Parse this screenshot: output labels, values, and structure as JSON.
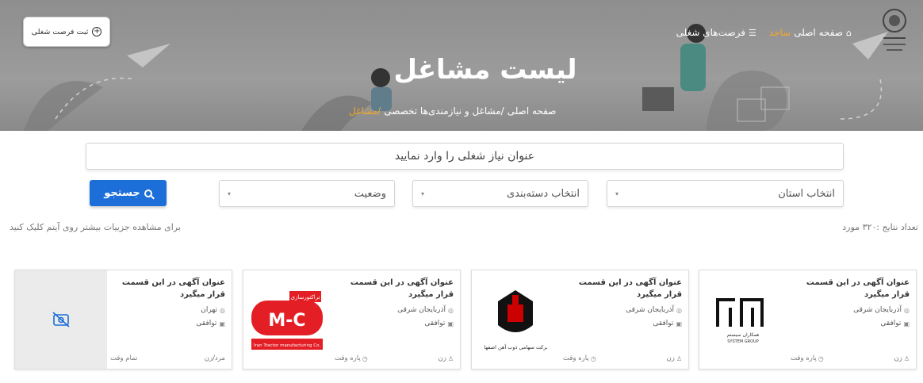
{
  "nav": {
    "home": "صفحه اصلی",
    "brand": "ساجد",
    "jobs": "فرصت‌های شغلی"
  },
  "post_job": {
    "label": "ثبت فرصت شغلی"
  },
  "hero": {
    "title": "لیست مشاغل",
    "breadcrumb": [
      "صفحه اصلی",
      "/مشاغل و نیازمندی‌ها تخصصی",
      "/مشاغل"
    ]
  },
  "search": {
    "placeholder": "عنوان نیاز شغلی را وارد نمایید",
    "province": "انتخاب استان",
    "category": "انتخاب دسته‌بندی",
    "status": "وضعیت",
    "button": "جستجو"
  },
  "results": {
    "count_text": "تعداد نتایج :۳۲۰ مورد",
    "hint": "برای مشاهده جزییات بیشتر روی آیتم کلیک کنید"
  },
  "cards": [
    {
      "title": "عنوان آگهی در این قسمت قرار میگیرد",
      "location": "آذربایجان شرقی",
      "salary": "توافقی",
      "gender": "زن",
      "type": "پاره وقت",
      "logo": "system-group-logo",
      "logo_text": "SYSTEM GROUP",
      "logo_fa": "همکاران سیستم"
    },
    {
      "title": "عنوان آگهی در این قسمت قرار میگیرد",
      "location": "آذربایجان شرقی",
      "salary": "توافقی",
      "gender": "زن",
      "type": "پاره وقت",
      "logo": "isfahan-steel-logo",
      "logo_text": "شرکت سهامی ذوب آهن اصفهان"
    },
    {
      "title": "عنوان آگهی در این قسمت قرار میگیرد",
      "location": "آذربایجان شرقی",
      "salary": "توافقی",
      "gender": "زن",
      "type": "پاره وقت",
      "logo": "itmco-logo",
      "logo_text": "Iran Tractor manufacturing Co.",
      "logo_fa": "تراکتورسازی"
    },
    {
      "title": "عنوان آگهی در این قسمت قرار میگیرد",
      "location": "تهران",
      "salary": "توافقی",
      "gender": "مرد/زن",
      "type": "تمام وقت",
      "logo": "no-image-icon"
    }
  ],
  "colors": {
    "accent": "#f4a72b",
    "primary": "#1c6ed8"
  }
}
